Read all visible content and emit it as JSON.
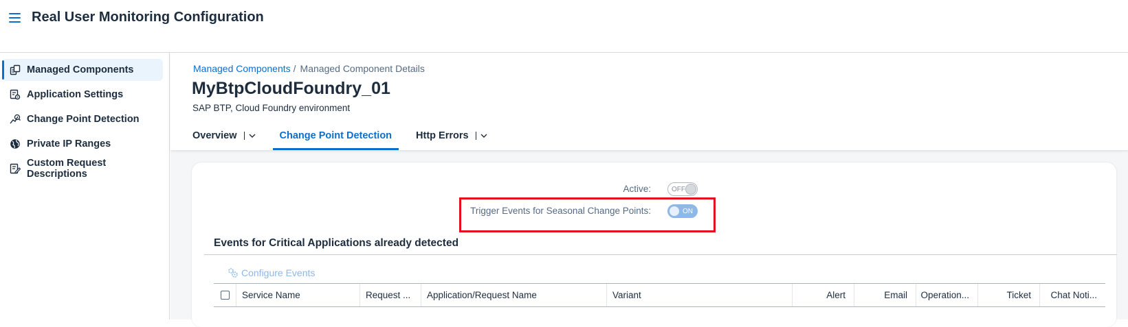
{
  "header": {
    "title": "Real User Monitoring Configuration",
    "menu_icon": "hamburger-menu-icon"
  },
  "sidebar": {
    "items": [
      {
        "label": "Managed Components",
        "icon": "managed-components-icon",
        "active": true
      },
      {
        "label": "Application Settings",
        "icon": "application-settings-icon",
        "active": false
      },
      {
        "label": "Change Point Detection",
        "icon": "change-point-icon",
        "active": false
      },
      {
        "label": "Private IP Ranges",
        "icon": "globe-icon",
        "active": false
      },
      {
        "label": "Custom Request Descriptions",
        "icon": "edit-document-icon",
        "active": false
      }
    ]
  },
  "breadcrumb": {
    "link": "Managed Components",
    "separator": "/",
    "current": "Managed Component Details"
  },
  "object": {
    "title": "MyBtpCloudFoundry_01",
    "subtitle": "SAP BTP, Cloud Foundry environment"
  },
  "tabs": [
    {
      "label": "Overview",
      "has_menu": true,
      "active": false
    },
    {
      "label": "Change Point Detection",
      "has_menu": false,
      "active": true
    },
    {
      "label": "Http Errors",
      "has_menu": true,
      "active": false
    }
  ],
  "form": {
    "active_label": "Active:",
    "active_state": "OFF",
    "seasonal_label": "Trigger Events for Seasonal Change Points:",
    "seasonal_state": "ON"
  },
  "events": {
    "title": "Events for Critical Applications already detected",
    "configure_label": "Configure Events",
    "columns": [
      "Service Name",
      "Request ...",
      "Application/Request Name",
      "Variant",
      "Alert",
      "Email",
      "Operation...",
      "Ticket",
      "Chat Noti..."
    ]
  },
  "colors": {
    "accent": "#0a6ed1",
    "highlight": "#e0101e",
    "switch_on": "#8db8e8"
  }
}
